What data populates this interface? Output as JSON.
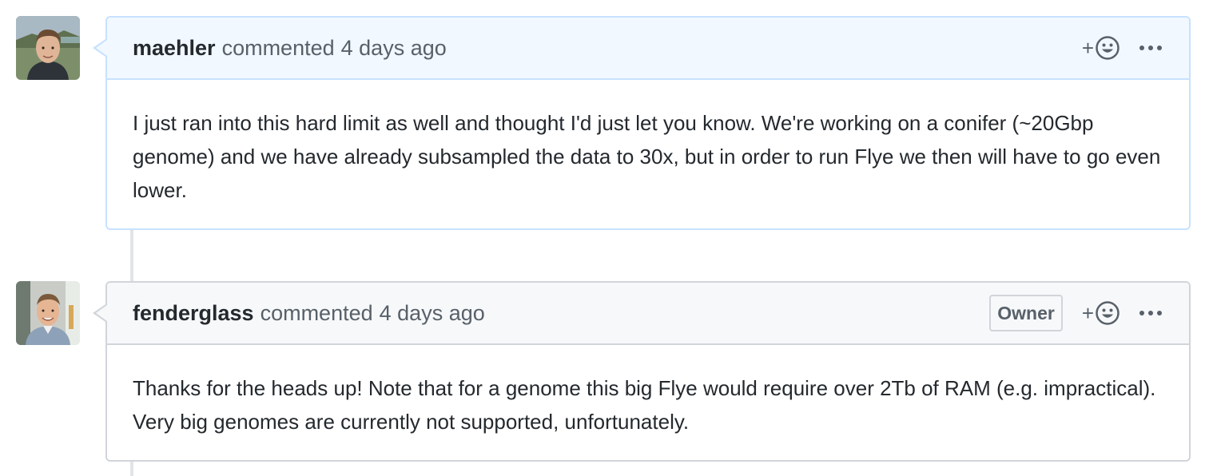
{
  "comments": [
    {
      "author": "maehler",
      "action": "commented",
      "time": "4 days ago",
      "badge": "",
      "body": "I just ran into this hard limit as well and thought I'd just let you know. We're working on a conifer (~20Gbp genome) and we have already subsampled the data to 30x, but in order to run Flye we then will have to go even lower."
    },
    {
      "author": "fenderglass",
      "action": "commented",
      "time": "4 days ago",
      "badge": "Owner",
      "body": "Thanks for the heads up! Note that for a genome this big Flye would require over 2Tb of RAM (e.g. impractical). Very big genomes are currently not supported, unfortunately."
    }
  ],
  "icons": {
    "reaction": "smiley-icon",
    "reaction_prefix": "+",
    "more": "kebab-horizontal-icon"
  },
  "colors": {
    "highlight_border": "#c8e1ff",
    "highlight_header": "#f1f8ff",
    "default_border": "#d1d5da",
    "default_header": "#f6f8fa",
    "text": "#24292e",
    "muted": "#586069"
  }
}
